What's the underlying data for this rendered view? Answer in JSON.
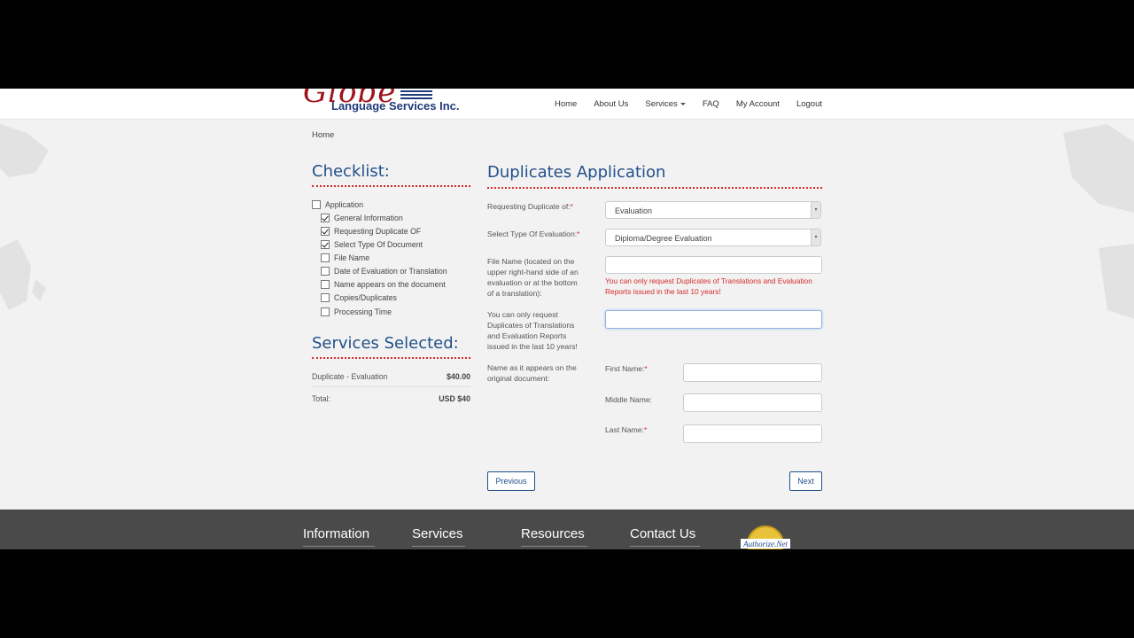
{
  "header": {
    "logo_word": "Globe",
    "logo_sub": "Language Services Inc.",
    "nav": [
      "Home",
      "About Us",
      "Services",
      "FAQ",
      "My Account",
      "Logout"
    ]
  },
  "breadcrumb": "Home",
  "checklist": {
    "title": "Checklist:",
    "items": [
      {
        "label": "Application",
        "checked": false
      },
      {
        "label": "General Information",
        "checked": true
      },
      {
        "label": "Requesting Duplicate OF",
        "checked": true
      },
      {
        "label": "Select Type Of Document",
        "checked": true
      },
      {
        "label": "File Name",
        "checked": false
      },
      {
        "label": "Date of Evaluation or Translation",
        "checked": false
      },
      {
        "label": "Name appears on the document",
        "checked": false
      },
      {
        "label": "Copies/Duplicates",
        "checked": false
      },
      {
        "label": "Processing Time",
        "checked": false
      }
    ]
  },
  "services": {
    "title": "Services Selected:",
    "item_label": "Duplicate - Evaluation",
    "item_amount": "$40.00",
    "total_label": "Total:",
    "total_amount": "USD $40"
  },
  "form": {
    "title": "Duplicates Application",
    "requesting_label": "Requesting Duplicate of:",
    "requesting_value": "Evaluation",
    "type_label": "Select Type Of Evaluation:",
    "type_value": "Diploma/Degree Evaluation",
    "file_label": "File Name (located on the upper right-hand side of an evaluation or at the bottom of a translation):",
    "file_error": "You can only request Duplicates of Translations and Evaluation Reports issued in the last 10 years!",
    "notice_label": "You can only request Duplicates of Translations and Evaluation Reports issued in the last 10 years!",
    "name_label": "Name as it appears on the original document:",
    "first_name_label": "First Name:",
    "middle_name_label": "Middle Name:",
    "last_name_label": "Last Name:",
    "required_mark": "*",
    "previous_label": "Previous",
    "next_label": "Next"
  },
  "footer": {
    "headings": [
      "Information",
      "Services",
      "Resources",
      "Contact Us"
    ],
    "badge": "Authorize.Net"
  },
  "colors": {
    "brand_blue": "#22508a",
    "logo_red": "#a0141e",
    "error_red": "#d62a2a",
    "footer_bg": "#4a4a4a"
  }
}
